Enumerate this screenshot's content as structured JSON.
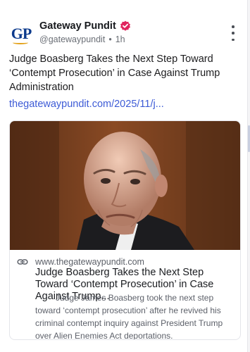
{
  "post": {
    "author_name": "Gateway Pundit",
    "avatar_initials": "GP",
    "handle": "@gatewaypundit",
    "separator": "•",
    "time_ago": "1h",
    "text": "Judge Boasberg Takes the Next Step Toward ‘Contempt Prosecution’ in Case Against Trump Administration",
    "link_text": "thegatewaypundit.com/2025/11/j..."
  },
  "embed": {
    "domain": "www.thegatewaypundit.com",
    "title": "Judge Boasberg Takes the Next Step Toward ‘Contempt Prosecution’ in Case Against Trump...",
    "description": "Judge James Boasberg took the next step toward ‘contempt prosecution’ after he revived his criminal contempt inquiry against President Trump over Alien Enemies Act deportations."
  },
  "icons": {
    "verified": "verified-badge-icon",
    "more": "more-vertical-icon",
    "link": "link-icon"
  },
  "colors": {
    "link": "#3d5bd6",
    "verified": "#e0245e",
    "brand_blue": "#0c3a8c",
    "brand_gold": "#e3a21a"
  }
}
